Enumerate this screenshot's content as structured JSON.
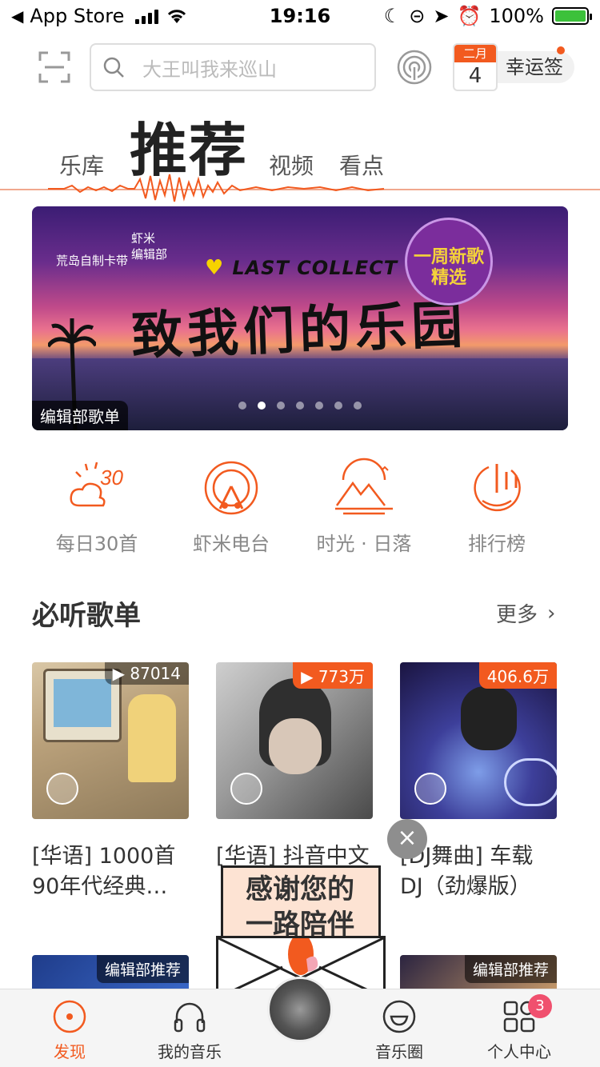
{
  "status_bar": {
    "back_label": "App Store",
    "time": "19:16",
    "battery": "100%"
  },
  "header": {
    "search_placeholder": "大王叫我来巡山",
    "calendar_month": "二月",
    "calendar_day": "4",
    "lucky_label": "幸运签"
  },
  "tabs": {
    "library": "乐库",
    "recommend": "推荐",
    "video": "视频",
    "view": "看点"
  },
  "banner": {
    "brand_line1": "荒岛自制卡带",
    "brand_line2": "虾米",
    "brand_line3": "编辑部",
    "collect": "LAST COLLECT",
    "title": "致我们的乐园",
    "badge": "一周新歌精选",
    "caption": "编辑部歌单",
    "dots": 7,
    "active_dot": 2
  },
  "quick_entries": [
    {
      "label": "每日30首",
      "icon": "daily-30-icon"
    },
    {
      "label": "虾米电台",
      "icon": "radio-tower-icon"
    },
    {
      "label": "时光 · 日落",
      "icon": "mountain-sunset-icon"
    },
    {
      "label": "排行榜",
      "icon": "chart-rank-icon"
    }
  ],
  "section": {
    "title": "必听歌单",
    "more": "更多"
  },
  "playlists": [
    {
      "count": "87014",
      "title_line1": "[华语] 1000首",
      "title_line2": "90年代经典…"
    },
    {
      "count": "773万",
      "title_line1": "[华语] 抖音中文",
      "title_line2": ""
    },
    {
      "count": "406.6万",
      "title_line1": "[DJ舞曲] 车载",
      "title_line2": "DJ（劲爆版）"
    }
  ],
  "second_row_tags": [
    "编辑部推荐",
    "编辑部推荐"
  ],
  "popup": {
    "text_line1": "感谢您的",
    "text_line2": "一路陪伴",
    "close": "×"
  },
  "tabbar": {
    "discover": "发现",
    "my_music": "我的音乐",
    "circle": "音乐圈",
    "profile": "个人中心",
    "profile_badge": "3"
  },
  "colors": {
    "accent": "#f25a1f",
    "badge_red": "#f0506e"
  }
}
